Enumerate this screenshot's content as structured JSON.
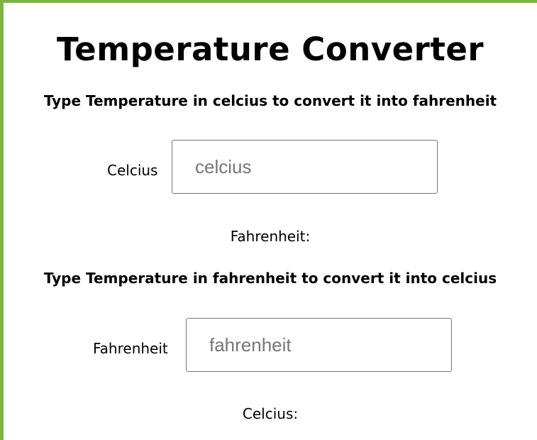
{
  "page": {
    "title": "Temperature Converter"
  },
  "celcius_section": {
    "instruction": "Type Temperature in celcius to convert it into fahrenheit",
    "input_label": "Celcius",
    "input_placeholder": "celcius",
    "input_value": "",
    "result_label": "Fahrenheit:",
    "result_value": ""
  },
  "fahrenheit_section": {
    "instruction": "Type Temperature in fahrenheit to convert it into celcius",
    "input_label": "Fahrenheit",
    "input_placeholder": "fahrenheit",
    "input_value": "",
    "result_label": "Celcius:",
    "result_value": ""
  },
  "colors": {
    "accent_border": "#7cb342"
  }
}
